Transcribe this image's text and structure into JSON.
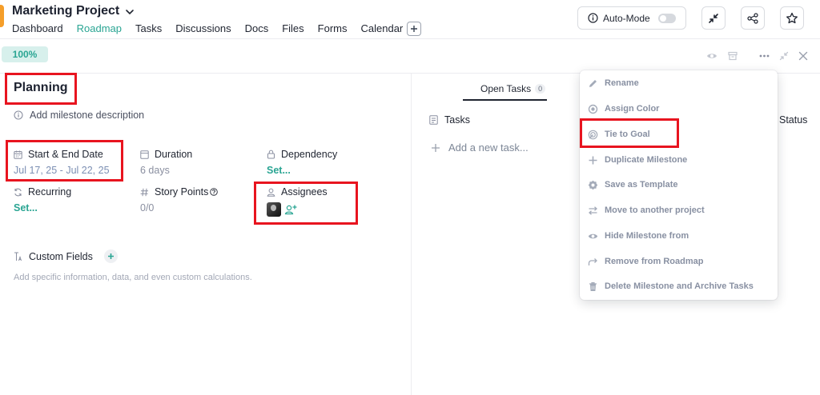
{
  "header": {
    "project_title": "Marketing Project",
    "nav": [
      {
        "label": "Dashboard",
        "active": false
      },
      {
        "label": "Roadmap",
        "active": true
      },
      {
        "label": "Tasks",
        "active": false
      },
      {
        "label": "Discussions",
        "active": false
      },
      {
        "label": "Docs",
        "active": false
      },
      {
        "label": "Files",
        "active": false
      },
      {
        "label": "Forms",
        "active": false
      },
      {
        "label": "Calendar",
        "active": false
      }
    ],
    "auto_mode_label": "Auto-Mode",
    "auto_mode_on": false
  },
  "subbar": {
    "progress_label": "100%",
    "progress": 1.0
  },
  "milestone": {
    "title": "Planning",
    "description_placeholder": "Add milestone description",
    "fields": {
      "dates": {
        "label": "Start & End Date",
        "value": "Jul 17, 25 - Jul 22, 25"
      },
      "duration": {
        "label": "Duration",
        "value": "6 days"
      },
      "dependency": {
        "label": "Dependency",
        "value": "Set..."
      },
      "recurring": {
        "label": "Recurring",
        "value": "Set..."
      },
      "story_points": {
        "label": "Story Points",
        "value": "0/0"
      },
      "assignees": {
        "label": "Assignees"
      }
    },
    "custom_fields": {
      "label": "Custom Fields",
      "hint": "Add specific information, data, and even custom calculations."
    }
  },
  "tasks_panel": {
    "tab_label": "Open Tasks",
    "tab_count": "0",
    "tasks_header": "Tasks",
    "status_header": "Status",
    "add_task_placeholder": "Add a new task..."
  },
  "context_menu": {
    "items": [
      {
        "label": "Rename",
        "icon": "pencil-icon"
      },
      {
        "label": "Assign Color",
        "icon": "color-dot-icon"
      },
      {
        "label": "Tie to Goal",
        "icon": "goal-target-icon"
      },
      {
        "label": "Duplicate Milestone",
        "icon": "plus-icon"
      },
      {
        "label": "Save as Template",
        "icon": "template-badge-icon"
      },
      {
        "label": "Move to another project",
        "icon": "move-arrows-icon"
      },
      {
        "label": "Hide Milestone from",
        "icon": "eye-icon"
      },
      {
        "label": "Remove from Roadmap",
        "icon": "share-arrow-icon"
      },
      {
        "label": "Delete Milestone and Archive Tasks",
        "icon": "trash-icon"
      }
    ]
  },
  "colors": {
    "accent": "#2aa593",
    "highlight_border": "#e8141f",
    "project_chip": "#f59e2a"
  }
}
